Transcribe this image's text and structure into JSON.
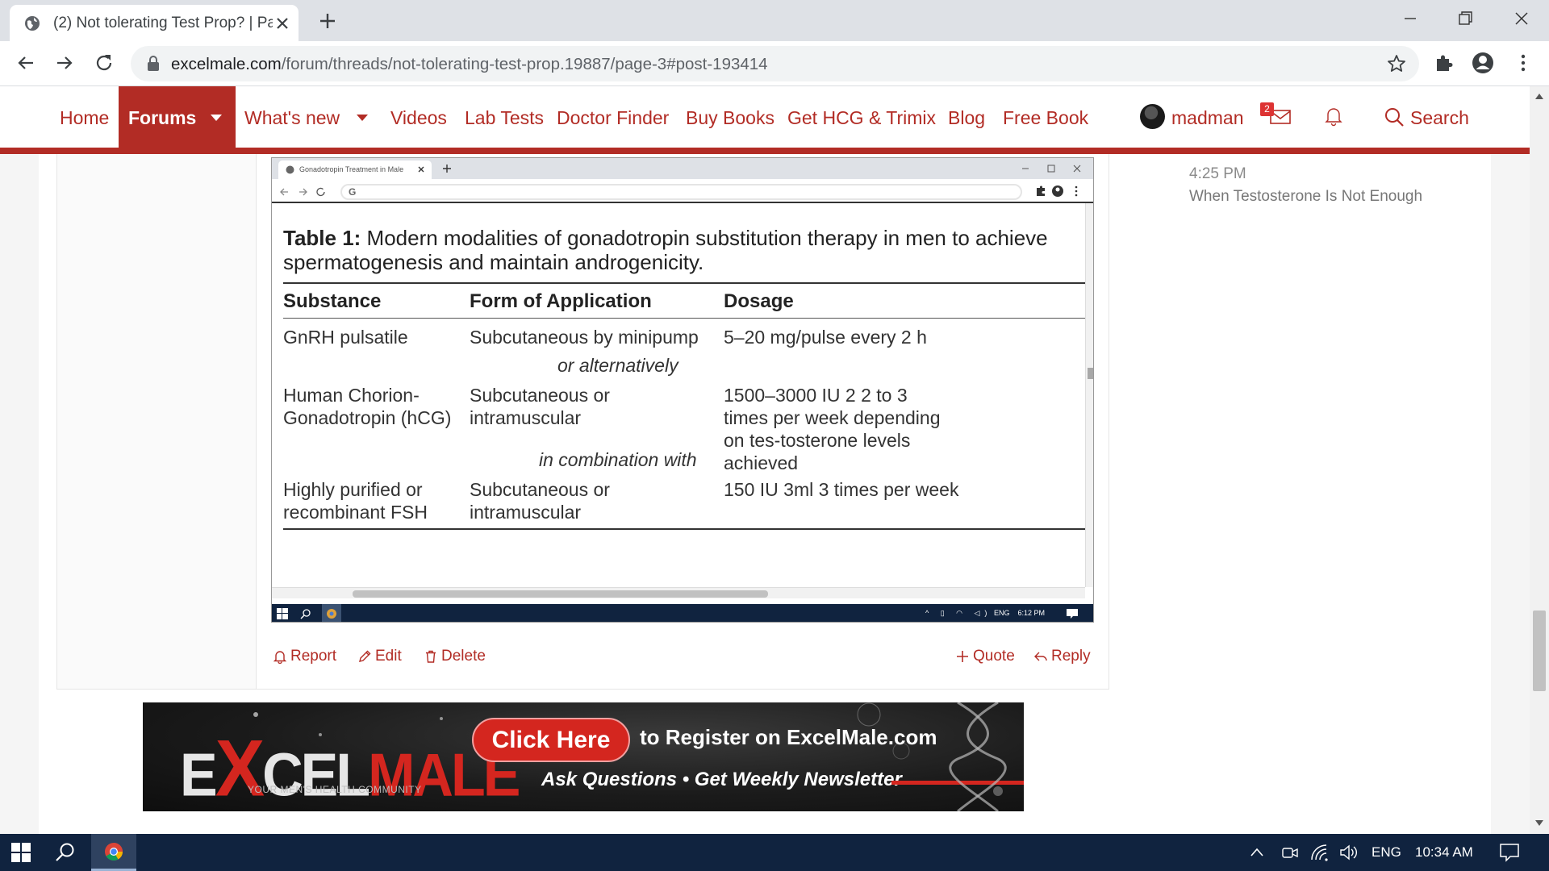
{
  "browser": {
    "tab_title": "(2) Not tolerating Test Prop? | Pa",
    "url_main": "excelmale.com",
    "url_path": "/forum/threads/not-tolerating-test-prop.19887/page-3#post-193414"
  },
  "nav": {
    "home": "Home",
    "forums": "Forums",
    "whats_new": "What's new",
    "videos": "Videos",
    "lab_tests": "Lab Tests",
    "doctor_finder": "Doctor Finder",
    "buy_books": "Buy Books",
    "get_hcg": "Get HCG & Trimix",
    "blog": "Blog",
    "free_book": "Free Book",
    "username": "madman",
    "inbox_count": "2",
    "search": "Search",
    "accent_color": "#b22c25"
  },
  "sidebar": {
    "time": "4:25 PM",
    "thread_title": "When Testosterone Is Not Enough"
  },
  "embedded": {
    "tab_title": "Gonadotropin Treatment in Male",
    "omnibox_glyph": "G",
    "caption_bold": "Table 1:",
    "caption_text": " Modern modalities of gonadotropin substitution therapy in men to achieve spermatogenesis and maintain androgenicity.",
    "headers": [
      "Substance",
      "Form of Application",
      "Dosage"
    ],
    "rows": [
      {
        "substance": "GnRH pulsatile",
        "form": "Subcutaneous by minipump",
        "dosage": "5–20 mg/pulse every 2 h"
      },
      {
        "substance": "Human Chorion-Gonadotropin (hCG)",
        "form": "Subcutaneous or intramuscular",
        "dosage": "1500–3000 IU 2 2 to 3 times per week depending on tes-tosterone levels achieved"
      },
      {
        "substance": "Highly purified or recombinant FSH",
        "form": "Subcutaneous or intramuscular",
        "dosage": "150 IU 3ml 3 times per week"
      }
    ],
    "separator_1": "or alternatively",
    "separator_2": "in combination with",
    "tray_lang": "ENG",
    "tray_time": "6:12 PM"
  },
  "actions": {
    "report": "Report",
    "edit": "Edit",
    "delete": "Delete",
    "quote": "Quote",
    "reply": "Reply"
  },
  "banner": {
    "logo_a": "E",
    "logo_x": "X",
    "logo_b": "CEL",
    "logo_c": "MALE",
    "logo_sub": "YOUR MEN'S HEALTH COMMUNITY",
    "cta": "Click Here",
    "line1": "to Register on ExcelMale.com",
    "line2": "Ask Questions • Get Weekly Newsletter"
  },
  "taskbar": {
    "lang": "ENG",
    "time": "10:34 AM"
  }
}
